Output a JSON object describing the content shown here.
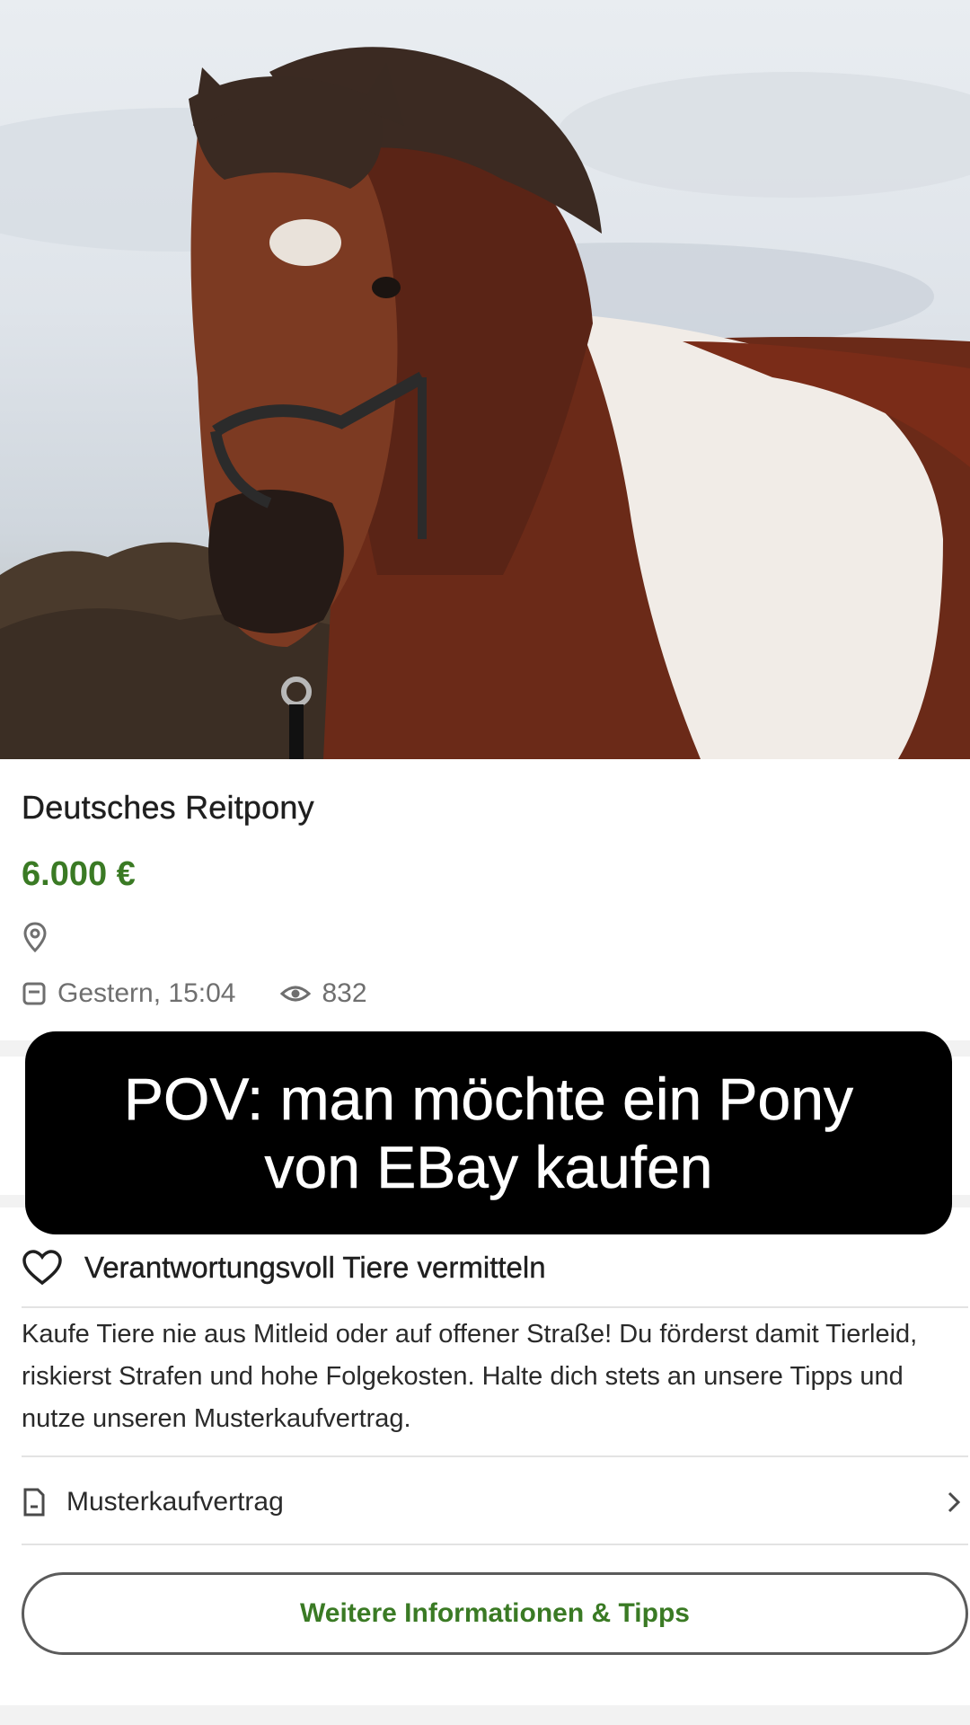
{
  "listing": {
    "title": "Deutsches Reitpony",
    "price": "6.000 €",
    "posted": "Gestern, 15:04",
    "views": "832"
  },
  "overlay": {
    "line1": "POV: man möchte ein Pony",
    "line2": "von EBay kaufen"
  },
  "responsibility": {
    "heading": "Verantwortungsvoll Tiere vermitteln",
    "text": "Kaufe Tiere nie aus Mitleid oder auf offener Straße! Du förderst damit Tierleid, riskierst Strafen und hohe Folgekosten. Halte dich stets an unsere Tipps und nutze unseren Musterkaufvertrag.",
    "contract_label": "Musterkaufvertrag",
    "button_label": "Weitere Informationen & Tipps"
  },
  "icons": {
    "location": "location-pin-icon",
    "calendar": "calendar-icon",
    "views": "eye-icon",
    "heart": "heart-icon",
    "document": "document-icon",
    "chevron": "chevron-right-icon"
  },
  "colors": {
    "price": "#3a7a24",
    "overlay_bg": "#000000",
    "muted_text": "#6f6f6f"
  }
}
